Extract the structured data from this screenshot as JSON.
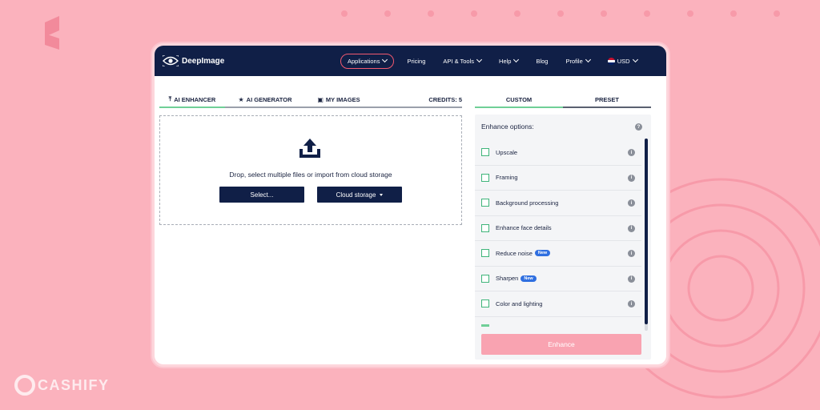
{
  "header": {
    "logo_text": "DeepImage",
    "nav": [
      {
        "label": "Applications",
        "has_dropdown": true,
        "active": true
      },
      {
        "label": "Pricing",
        "has_dropdown": false
      },
      {
        "label": "API & Tools",
        "has_dropdown": true
      },
      {
        "label": "Help",
        "has_dropdown": true
      },
      {
        "label": "Blog",
        "has_dropdown": false
      },
      {
        "label": "Profile",
        "has_dropdown": true
      },
      {
        "label": "USD",
        "has_dropdown": true,
        "icon": "uk-flag-icon"
      }
    ]
  },
  "left_tabs": [
    {
      "label": "AI ENHANCER",
      "icon": "upload-icon"
    },
    {
      "label": "AI GENERATOR",
      "icon": "star-icon"
    },
    {
      "label": "MY IMAGES",
      "icon": "images-icon"
    }
  ],
  "credits": "CREDITS: 5",
  "dropzone": {
    "text": "Drop, select multiple files or import from cloud storage",
    "select_label": "Select...",
    "cloud_label": "Cloud storage"
  },
  "right_tabs": [
    {
      "label": "CUSTOM",
      "active": true
    },
    {
      "label": "PRESET",
      "active": false
    }
  ],
  "enhance_options": {
    "title": "Enhance options:",
    "items": [
      {
        "label": "Upscale",
        "badge": ""
      },
      {
        "label": "Framing",
        "badge": ""
      },
      {
        "label": "Background processing",
        "badge": ""
      },
      {
        "label": "Enhance face details",
        "badge": ""
      },
      {
        "label": "Reduce noise",
        "badge": "New"
      },
      {
        "label": "Sharpen",
        "badge": "New"
      },
      {
        "label": "Color and lighting",
        "badge": ""
      }
    ],
    "enhance_label": "Enhance"
  },
  "watermark": "CASHIFY",
  "colors": {
    "navy": "#101f47",
    "accent_pink": "#f2596f",
    "green": "#6fcf97",
    "background": "#fbb2bd"
  }
}
